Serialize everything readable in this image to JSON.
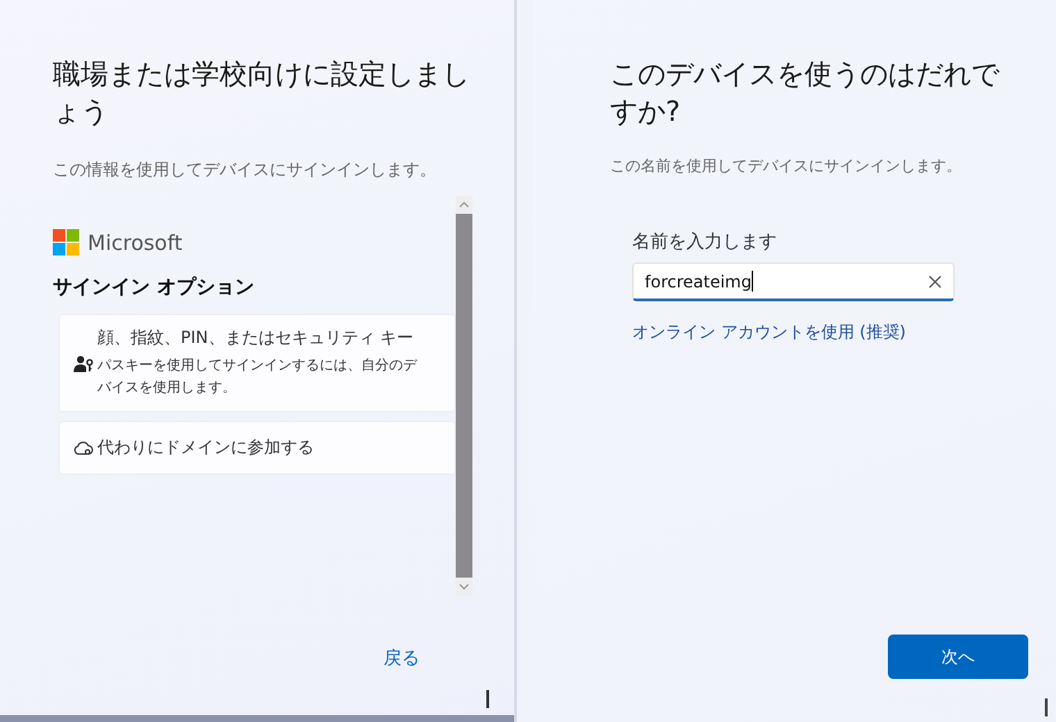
{
  "left_panel": {
    "title": "職場または学校向けに設定しましょう",
    "subtitle": "この情報を使用してデバイスにサインインします。",
    "brand": "Microsoft",
    "section_title": "サインイン オプション",
    "options": [
      {
        "kind": "passkey",
        "title": "顔、指紋、PIN、またはセキュリティ キー",
        "description": "パスキーを使用してサインインするには、自分のデバイスを使用します。"
      },
      {
        "kind": "domain",
        "title": "代わりにドメインに参加する"
      }
    ],
    "back_link": "戻る"
  },
  "right_panel": {
    "title": "このデバイスを使うのはだれですか?",
    "subtitle": "この名前を使用してデバイスにサインインします。",
    "field_label": "名前を入力します",
    "name_field": {
      "value": "forcreateimg"
    },
    "online_account_link": "オンライン アカウントを使用 (推奨)",
    "next_button": "次へ"
  }
}
